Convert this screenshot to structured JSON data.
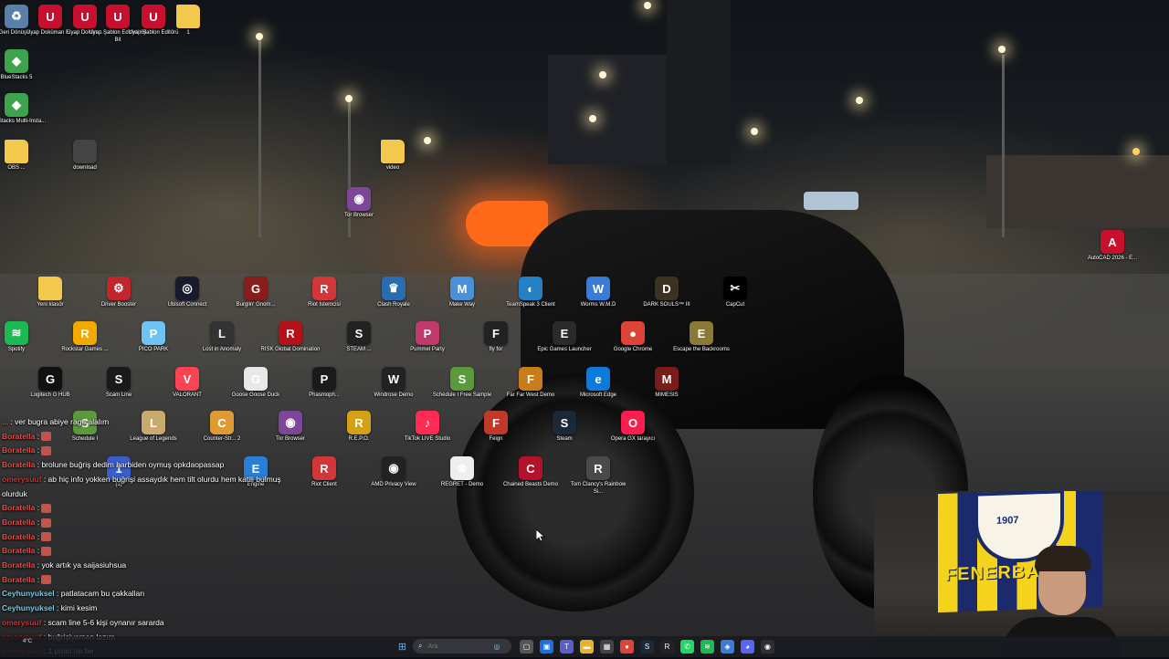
{
  "desktop_icons": [
    {
      "label": "Geri Dönüşü...",
      "icon": "recycle-bin-icon",
      "color": "#5a7fa8",
      "glyph": "♻"
    },
    {
      "label": "Uyap Doküman E...",
      "icon": "uyap-icon",
      "color": "#c8102e",
      "glyph": "U"
    },
    {
      "label": "Uyap Doküm...",
      "icon": "uyap-icon",
      "color": "#c8102e",
      "glyph": "U"
    },
    {
      "label": "Uyap Şablon Editörü 64 Bit",
      "icon": "uyap-icon",
      "color": "#c8102e",
      "glyph": "U"
    },
    {
      "label": "Uyap Şablon Editörü",
      "icon": "uyap-icon",
      "color": "#c8102e",
      "glyph": "U"
    },
    {
      "label": "1",
      "icon": "folder-icon",
      "color": "#f2c94c",
      "glyph": ""
    },
    {
      "label": "BlueStacks 5",
      "icon": "bluestacks-icon",
      "color": "#3fa34d",
      "glyph": "◆"
    },
    {
      "label": "BlueStacks Multi-Insta...",
      "icon": "bluestacks-icon",
      "color": "#3fa34d",
      "glyph": "◆"
    },
    {
      "label": "OBS ...",
      "icon": "folder-icon",
      "color": "#f2c94c",
      "glyph": ""
    },
    {
      "label": "download",
      "icon": "file-icon",
      "color": "#444444",
      "glyph": ""
    },
    {
      "label": "video",
      "icon": "folder-icon",
      "color": "#f2c94c",
      "glyph": ""
    },
    {
      "label": "Tor Browser",
      "icon": "tor-icon",
      "color": "#7d4698",
      "glyph": "◉"
    },
    {
      "label": "AutoCAD 2026 - E...",
      "icon": "autocad-icon",
      "color": "#c8102e",
      "glyph": "A"
    },
    {
      "label": "Yeni klasör",
      "icon": "folder-icon",
      "color": "#f2c94c",
      "glyph": ""
    },
    {
      "label": "Driver Booster",
      "icon": "driver-booster-icon",
      "color": "#c0272d",
      "glyph": "⚙"
    },
    {
      "label": "Ubisoft Connect",
      "icon": "ubisoft-icon",
      "color": "#1a1a2e",
      "glyph": "◎"
    },
    {
      "label": "Burglin' Gnom...",
      "icon": "game-icon",
      "color": "#8b1c1c",
      "glyph": "G"
    },
    {
      "label": "Riot İstemcisi",
      "icon": "riot-icon",
      "color": "#d13639",
      "glyph": "R"
    },
    {
      "label": "Clash Royale",
      "icon": "clash-royale-icon",
      "color": "#2b6cb0",
      "glyph": "♛"
    },
    {
      "label": "Make Way",
      "icon": "game-icon",
      "color": "#4a90d9",
      "glyph": "M"
    },
    {
      "label": "TeamSpeak 3 Client",
      "icon": "teamspeak-icon",
      "color": "#2580c3",
      "glyph": "◐"
    },
    {
      "label": "Worms W.M.D",
      "icon": "game-icon",
      "color": "#3a7bd5",
      "glyph": "W"
    },
    {
      "label": "DARK SOULS™ III",
      "icon": "game-icon",
      "color": "#3c3222",
      "glyph": "D"
    },
    {
      "label": "CapCut",
      "icon": "capcut-icon",
      "color": "#000000",
      "glyph": "✂"
    },
    {
      "label": "Spotify",
      "icon": "spotify-icon",
      "color": "#1db954",
      "glyph": "≋"
    },
    {
      "label": "Rockstar Games ...",
      "icon": "rockstar-icon",
      "color": "#f2a900",
      "glyph": "R"
    },
    {
      "label": "PICO PARK",
      "icon": "game-icon",
      "color": "#6ec3f4",
      "glyph": "P"
    },
    {
      "label": "Lost in Anomaly",
      "icon": "game-icon",
      "color": "#333333",
      "glyph": "L"
    },
    {
      "label": "RISK Global Domination",
      "icon": "game-icon",
      "color": "#b3121a",
      "glyph": "R"
    },
    {
      "label": "STEAM ...",
      "icon": "game-icon",
      "color": "#222222",
      "glyph": "S"
    },
    {
      "label": "Pummel Party",
      "icon": "game-icon",
      "color": "#c0396b",
      "glyph": "P"
    },
    {
      "label": "fly for",
      "icon": "game-icon",
      "color": "#222222",
      "glyph": "F"
    },
    {
      "label": "Epic Games Launcher",
      "icon": "epic-games-icon",
      "color": "#2a2a2a",
      "glyph": "E"
    },
    {
      "label": "Google Chrome",
      "icon": "chrome-icon",
      "color": "#db4437",
      "glyph": "●"
    },
    {
      "label": "Escape the Backrooms",
      "icon": "game-icon",
      "color": "#8a7a3a",
      "glyph": "E"
    },
    {
      "label": "Logitech G HUB",
      "icon": "logitech-icon",
      "color": "#111111",
      "glyph": "G"
    },
    {
      "label": "Scam Line",
      "icon": "game-icon",
      "color": "#1a1a1a",
      "glyph": "S"
    },
    {
      "label": "VALORANT",
      "icon": "valorant-icon",
      "color": "#fa4454",
      "glyph": "V"
    },
    {
      "label": "Goose Goose Duck",
      "icon": "game-icon",
      "color": "#e8e8e8",
      "glyph": "G"
    },
    {
      "label": "Phasmoph...",
      "icon": "game-icon",
      "color": "#1a1a1a",
      "glyph": "P"
    },
    {
      "label": "Windrose Demo",
      "icon": "game-icon",
      "color": "#222222",
      "glyph": "W"
    },
    {
      "label": "Schedule I Free Sample",
      "icon": "game-icon",
      "color": "#5b9a3c",
      "glyph": "S"
    },
    {
      "label": "Far Far West Demo",
      "icon": "game-icon",
      "color": "#c77d1a",
      "glyph": "F"
    },
    {
      "label": "Microsoft Edge",
      "icon": "edge-icon",
      "color": "#0c7bdc",
      "glyph": "e"
    },
    {
      "label": "MIMESIS",
      "icon": "game-icon",
      "color": "#7a1c1c",
      "glyph": "M"
    },
    {
      "label": "Schedule I",
      "icon": "game-icon",
      "color": "#5b9a3c",
      "glyph": "S"
    },
    {
      "label": "League of Legends",
      "icon": "lol-icon",
      "color": "#c8aa6e",
      "glyph": "L"
    },
    {
      "label": "Counter-Str... 2",
      "icon": "cs2-icon",
      "color": "#de9b35",
      "glyph": "C"
    },
    {
      "label": "Tor Browser",
      "icon": "tor-icon",
      "color": "#7d4698",
      "glyph": "◉"
    },
    {
      "label": "R.E.P.O.",
      "icon": "game-icon",
      "color": "#d4a017",
      "glyph": "R"
    },
    {
      "label": "TikTok LIVE Studio",
      "icon": "tiktok-icon",
      "color": "#fe2c55",
      "glyph": "♪"
    },
    {
      "label": "Feign",
      "icon": "game-icon",
      "color": "#c0392b",
      "glyph": "F"
    },
    {
      "label": "Steam",
      "icon": "steam-icon",
      "color": "#1b2838",
      "glyph": "S"
    },
    {
      "label": "Opera GX tarayıcı",
      "icon": "opera-gx-icon",
      "color": "#fa1e4e",
      "glyph": "O"
    },
    {
      "label": "(1)",
      "icon": "game-icon",
      "color": "#3a5fcd",
      "glyph": "1"
    },
    {
      "label": "Engine",
      "icon": "game-icon",
      "color": "#2a7fd4",
      "glyph": "E"
    },
    {
      "label": "Riot Client",
      "icon": "riot-icon",
      "color": "#d13639",
      "glyph": "R"
    },
    {
      "label": "AMD Privacy View",
      "icon": "amd-icon",
      "color": "#222222",
      "glyph": "◉"
    },
    {
      "label": "REGRET - Demo",
      "icon": "game-icon",
      "color": "#eeeeee",
      "glyph": "⊗"
    },
    {
      "label": "Chained Beasts Demo",
      "icon": "game-icon",
      "color": "#b3122a",
      "glyph": "C"
    },
    {
      "label": "Tom Clancy's Rainbow Si...",
      "icon": "game-icon",
      "color": "#4a4a4a",
      "glyph": "R"
    }
  ],
  "chat": [
    {
      "user": "...",
      "color": "#e05050",
      "message": ": ver bugra abiye rage alalım",
      "emote": false
    },
    {
      "user": "Boratella",
      "color": "#e05050",
      "message": ":",
      "emote": true
    },
    {
      "user": "Boratella",
      "color": "#e05050",
      "message": ":",
      "emote": true
    },
    {
      "user": "Boratella",
      "color": "#e05050",
      "message": ": brolune buğriş dedim harbiden oymuş opkdaopassap",
      "emote": false
    },
    {
      "user": "omerysuuf",
      "color": "#c03a3a",
      "message": ": ab hiç info yokken buğrişi assaydık hem tilt olurdu hem katili bulmuş",
      "emote": false
    },
    {
      "user": "",
      "color": "#ffffff",
      "message": "olurduk",
      "emote": false
    },
    {
      "user": "Boratella",
      "color": "#e05050",
      "message": ":",
      "emote": true
    },
    {
      "user": "Boratella",
      "color": "#e05050",
      "message": ":",
      "emote": true
    },
    {
      "user": "Boratella",
      "color": "#e05050",
      "message": ":",
      "emote": true
    },
    {
      "user": "Boratella",
      "color": "#e05050",
      "message": ":",
      "emote": true
    },
    {
      "user": "Boratella",
      "color": "#e05050",
      "message": ": yok artık ya saijasiuhsua",
      "emote": false
    },
    {
      "user": "Boratella",
      "color": "#e05050",
      "message": ":",
      "emote": true
    },
    {
      "user": "Ceyhunyuksel",
      "color": "#7ec8e3",
      "message": ": patlatacam bu çakkalları",
      "emote": false
    },
    {
      "user": "Ceyhunyuksel",
      "color": "#7ec8e3",
      "message": ": kimi kesim",
      "emote": false
    },
    {
      "user": "omerysuuf",
      "color": "#c03a3a",
      "message": ": scam line 5-6 kişi oynanır sararda",
      "emote": false
    },
    {
      "user": "omerysuuf",
      "color": "#c03a3a",
      "message": ": buğrişiyemen lazım",
      "emote": false
    },
    {
      "user": "omerysuuf",
      "color": "#c03a3a",
      "message": ": 1 puan ne be",
      "emote": false
    }
  ],
  "webcam": {
    "flag_text": "FENERBAHÇ",
    "flag_year": "1907"
  },
  "taskbar": {
    "weather": "4°C",
    "search_placeholder": "Ara",
    "apps": [
      "start-icon",
      "copilot-icon",
      "task-view-icon",
      "store-icon",
      "teams-icon",
      "file-explorer-icon",
      "calculator-icon",
      "chrome-icon",
      "steam-icon",
      "rockstar-icon",
      "whatsapp-icon",
      "spotify-icon",
      "app-icon",
      "discord-icon",
      "obs-icon"
    ]
  }
}
